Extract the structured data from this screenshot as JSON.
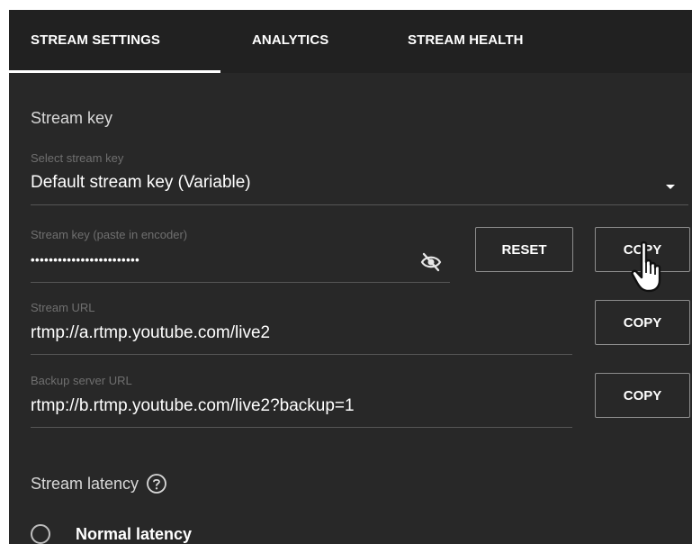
{
  "tabs": {
    "stream_settings": "STREAM SETTINGS",
    "analytics": "ANALYTICS",
    "stream_health": "STREAM HEALTH"
  },
  "stream_key_section": {
    "title": "Stream key"
  },
  "select_stream_key": {
    "label": "Select stream key",
    "value": "Default stream key (Variable)"
  },
  "stream_key_field": {
    "label": "Stream key (paste in encoder)",
    "masked_value": "••••••••••••••••••••••••",
    "visibility_icon": "eye-off-icon"
  },
  "buttons": {
    "reset": "RESET",
    "copy_key": "COPY",
    "copy_url": "COPY",
    "copy_backup": "COPY"
  },
  "stream_url": {
    "label": "Stream URL",
    "value": "rtmp://a.rtmp.youtube.com/live2"
  },
  "backup_url": {
    "label": "Backup server URL",
    "value": "rtmp://b.rtmp.youtube.com/live2?backup=1"
  },
  "latency_section": {
    "title": "Stream latency",
    "help_icon": "help-circle-icon"
  },
  "latency_options": {
    "normal": "Normal latency"
  },
  "colors": {
    "panel_bg": "#282828",
    "tabbar_bg": "#212121",
    "text": "#ffffff",
    "muted": "#6f6f6f"
  },
  "cursor": "hand-pointer-icon"
}
